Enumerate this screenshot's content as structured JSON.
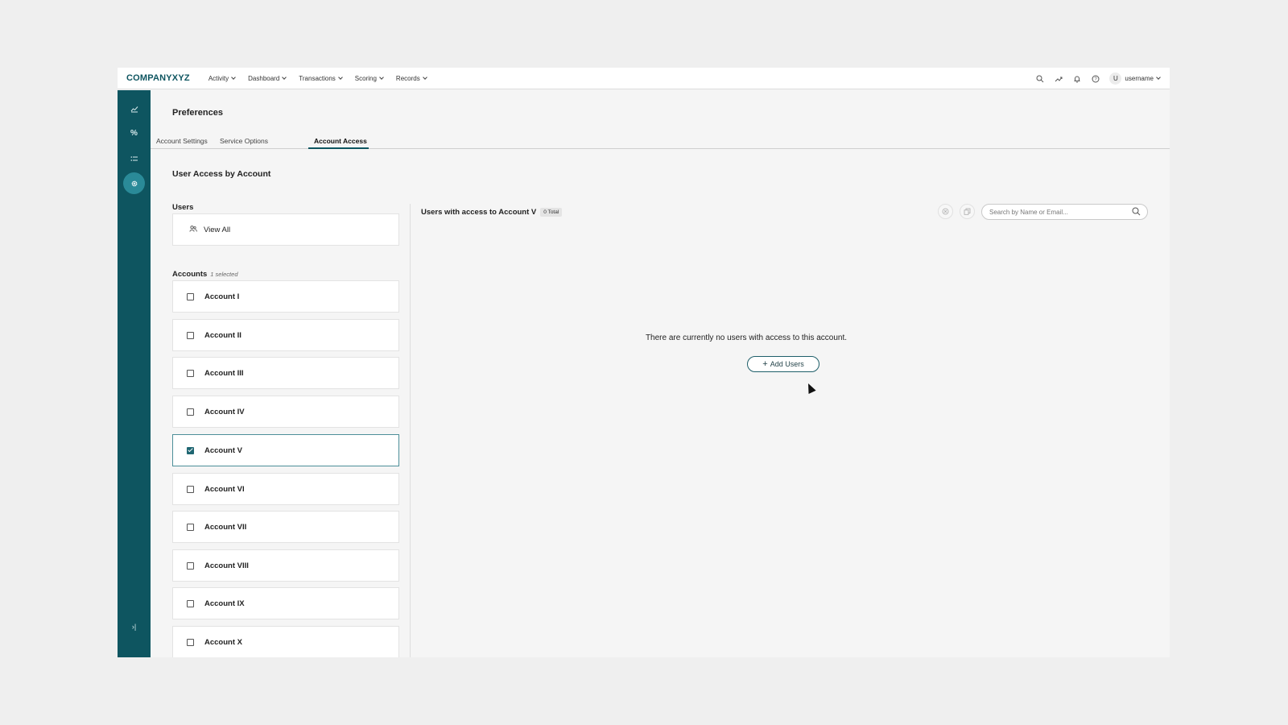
{
  "topbar": {
    "logo": "COMPANYXYZ",
    "nav": [
      "Activity",
      "Dashboard",
      "Transactions",
      "Scoring",
      "Records"
    ],
    "user_initial": "U",
    "user_name": "username"
  },
  "page": {
    "title": "Preferences",
    "tabs": [
      "Account Settings",
      "Service Options",
      "Account Access"
    ],
    "active_tab": "Account Access",
    "section_title": "User Access by Account"
  },
  "users": {
    "label": "Users",
    "view_all": "View All"
  },
  "accounts": {
    "label": "Accounts",
    "selected_count": "1 selected",
    "items": [
      {
        "label": "Account I",
        "checked": false
      },
      {
        "label": "Account II",
        "checked": false
      },
      {
        "label": "Account III",
        "checked": false
      },
      {
        "label": "Account IV",
        "checked": false
      },
      {
        "label": "Account V",
        "checked": true
      },
      {
        "label": "Account VI",
        "checked": false
      },
      {
        "label": "Account VII",
        "checked": false
      },
      {
        "label": "Account VIII",
        "checked": false
      },
      {
        "label": "Account IX",
        "checked": false
      },
      {
        "label": "Account X",
        "checked": false
      }
    ]
  },
  "access_panel": {
    "title": "Users with access to Account V",
    "total_badge": "0 Total",
    "search_placeholder": "Search by Name or Email...",
    "empty_message": "There are currently no users with access to this account.",
    "add_button": "Add Users"
  },
  "colors": {
    "brand": "#0e5560",
    "sidebar_active": "#2a8a98",
    "checkbox_checked": "#1f6672"
  }
}
